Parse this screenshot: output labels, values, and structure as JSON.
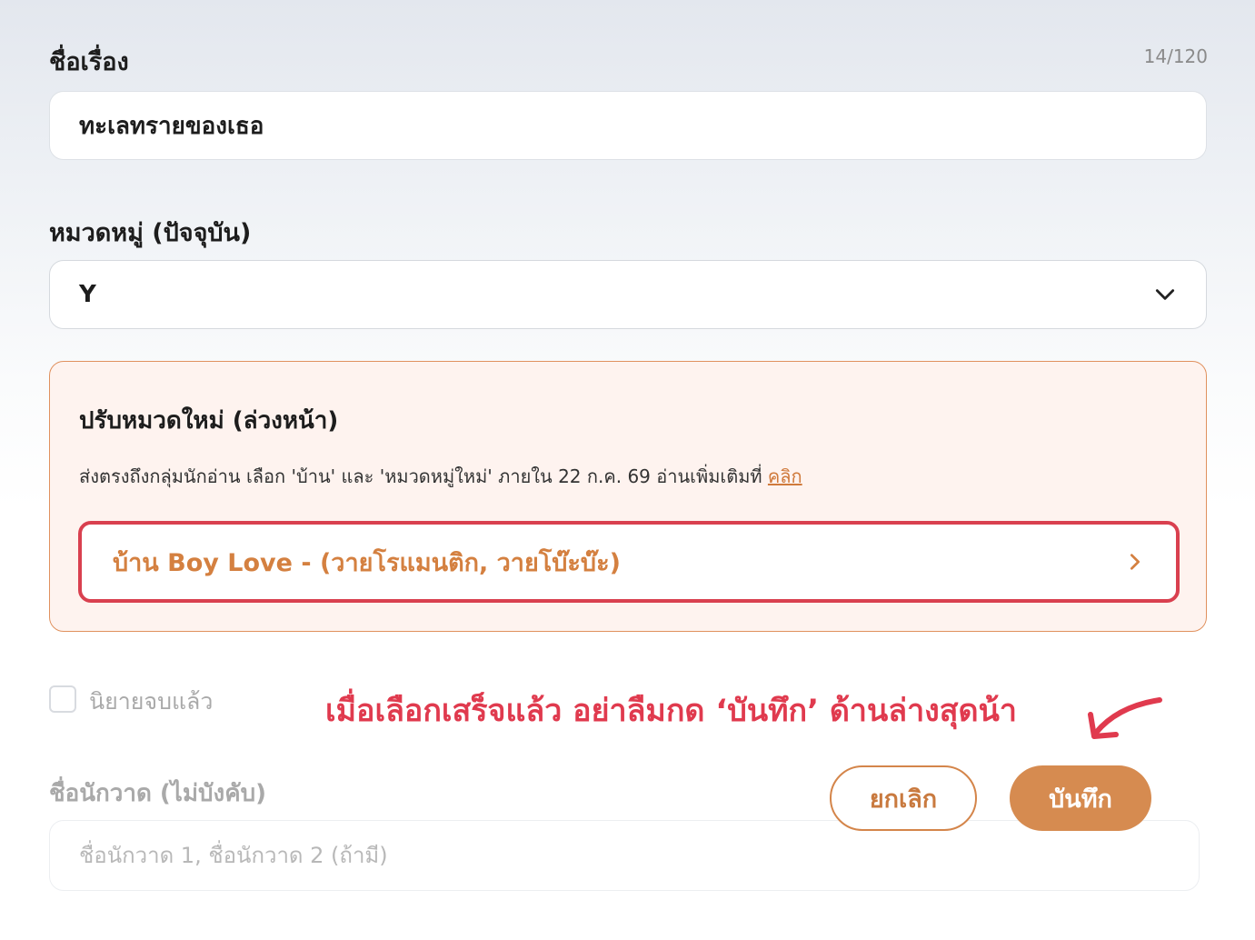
{
  "title_field": {
    "label": "ชื่อเรื่อง",
    "char_count": "14/120",
    "value": "ทะเลทรายของเธอ"
  },
  "category_field": {
    "label": "หมวดหมู่ (ปัจจุบัน)",
    "selected": "Y",
    "icon": "chevron-down-icon"
  },
  "notice": {
    "title": "ปรับหมวดใหม่ (ล่วงหน้า)",
    "description": "ส่งตรงถึงกลุ่มนักอ่าน เลือก 'บ้าน' และ 'หมวดหมู่ใหม่' ภายใน 22 ก.ค. 69 อ่านเพิ่มเติมที่ ",
    "link_text": "คลิก",
    "option_label": "บ้าน Boy Love - (วายโรแมนติก, วายโบ๊ะบ๊ะ)",
    "option_icon": "chevron-right-icon"
  },
  "finished_checkbox": {
    "label": "นิยายจบแล้ว",
    "checked": false
  },
  "hint": {
    "text": "เมื่อเลือกเสร็จแล้ว อย่าลืมกด ‘บันทึก’ ด้านล่างสุดน้า",
    "icon": "curved-arrow-icon"
  },
  "artist_field": {
    "label": "ชื่อนักวาด (ไม่บังคับ)",
    "placeholder": "ชื่อนักวาด 1, ชื่อนักวาด 2 (ถ้ามี)"
  },
  "actions": {
    "cancel_label": "ยกเลิก",
    "save_label": "บันทึก"
  },
  "colors": {
    "accent_orange": "#d68b50",
    "highlight_red": "#d9404f",
    "notice_bg": "#fef3ef"
  }
}
